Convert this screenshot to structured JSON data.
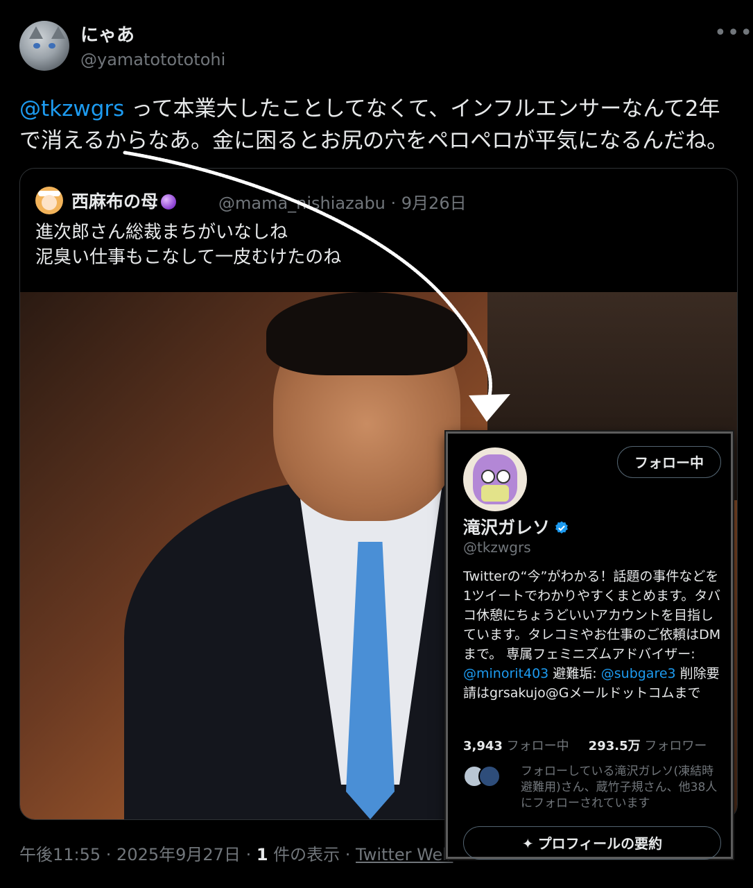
{
  "tweet": {
    "display_name": "にゃあ",
    "handle": "@yamatotototohi",
    "more_icon": "more-horizontal-icon",
    "mention": "@tkzwgrs",
    "text": " って本業大したことしてなくて、インフルエンサーなんて2年で消えるからなあ。金に困るとお尻の穴をペロペロが平気になるんだね。",
    "timestamp": "午後11:55 · 2025年9月27日 · ",
    "view_count": "1",
    "view_label": " 件の表示 · ",
    "source": "Twitter Web"
  },
  "quoted": {
    "display_name": "西麻布の母",
    "handle_date": "@mama_nishiazabu · 9月26日",
    "line1": "進次郎さん総裁まちがいなしね",
    "line2": "泥臭い仕事もこなして一皮むけたのね"
  },
  "profile_card": {
    "follow_button": "フォロー中",
    "name": "滝沢ガレソ",
    "handle": "@tkzwgrs",
    "bio_part1": "Twitterの“今”がわかる！話題の事件などを1ツイートでわかりやすくまとめます。タバコ休憩にちょうどいいアカウントを目指しています。タレコミやお仕事のご依頼はDMまで。 専属フェミニズムアドバイザー: ",
    "bio_mention1": "@minorit403",
    "bio_part2": " 避難垢: ",
    "bio_mention2": "@subgare3",
    "bio_part3": " 削除要請はgrsakujo@Gメールドットコムまで",
    "following_count": "3,943",
    "following_label": " フォロー中",
    "followers_count": "293.5万",
    "followers_label": " フォロワー",
    "mutual_text": "フォローしている滝沢ガレソ(凍結時避難用)さん、蔵竹子規さん、他38人にフォローされています",
    "summary_button": "プロフィールの要約"
  },
  "colors": {
    "accent": "#1d9bf0",
    "muted": "#71767b",
    "text": "#e7e9ea",
    "background": "#000000"
  }
}
